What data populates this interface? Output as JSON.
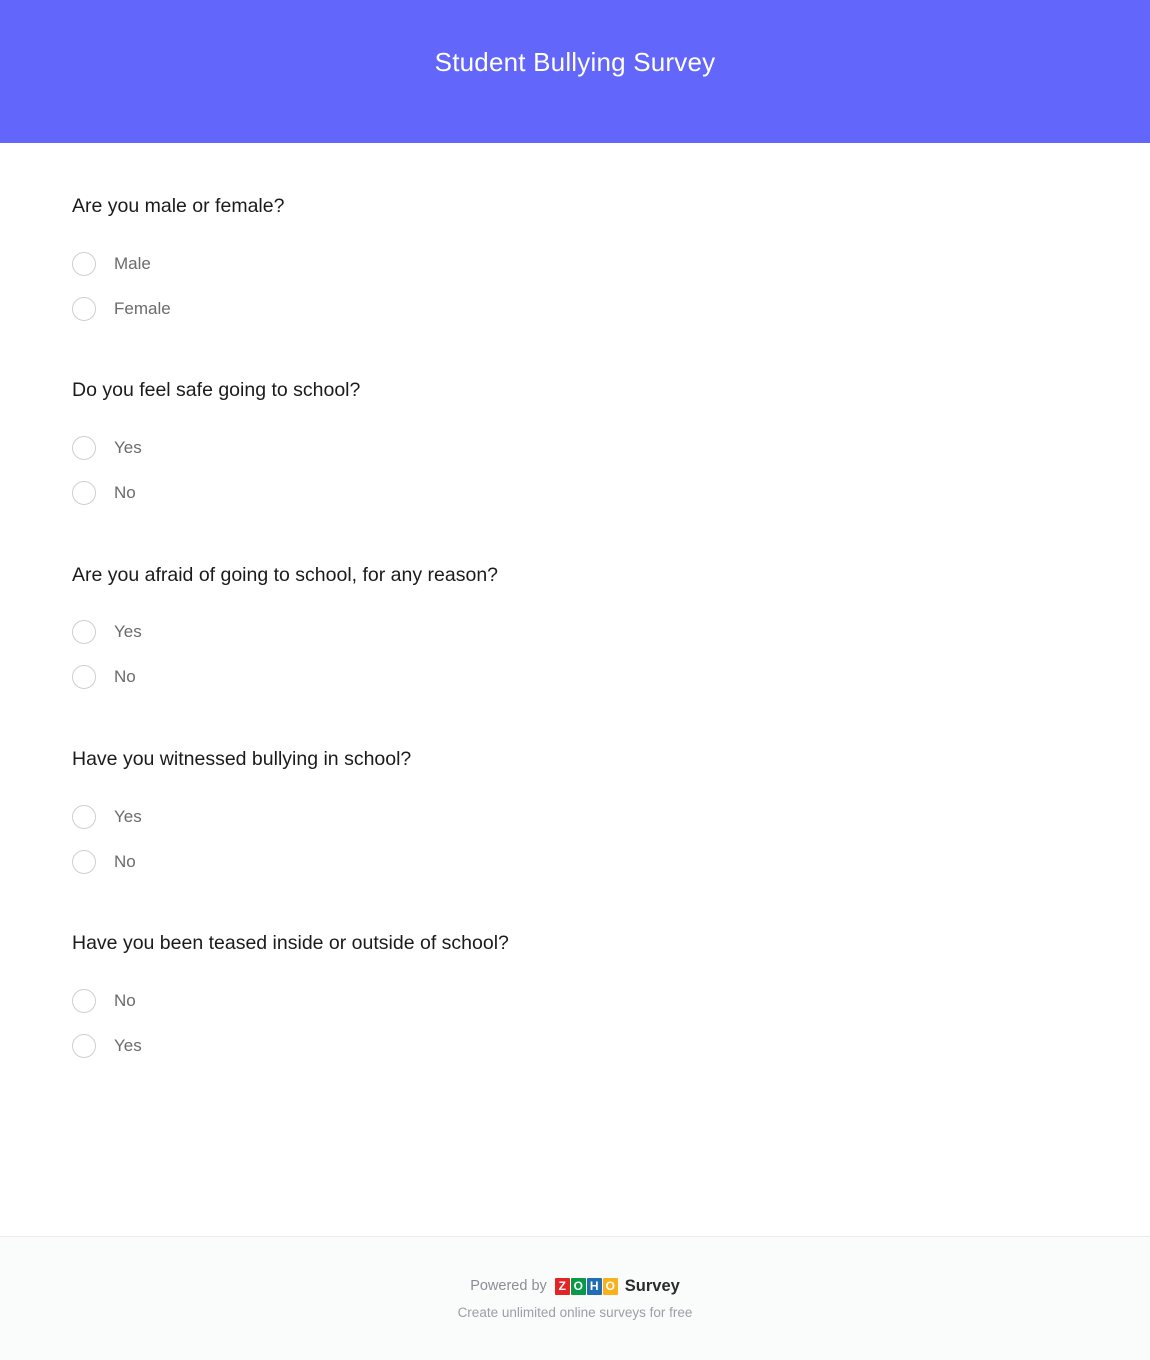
{
  "header": {
    "title": "Student Bullying Survey",
    "background_color": "#6366fa",
    "title_color": "#ffffff"
  },
  "questions": [
    {
      "text": "Are you male or female?",
      "options": [
        {
          "label": "Male"
        },
        {
          "label": "Female"
        }
      ]
    },
    {
      "text": "Do you feel safe going to school?",
      "options": [
        {
          "label": "Yes"
        },
        {
          "label": "No"
        }
      ]
    },
    {
      "text": "Are you afraid of going to school, for any reason?",
      "options": [
        {
          "label": "Yes"
        },
        {
          "label": "No"
        }
      ]
    },
    {
      "text": "Have you witnessed bullying in school?",
      "options": [
        {
          "label": "Yes"
        },
        {
          "label": "No"
        }
      ]
    },
    {
      "text": "Have you been teased inside or outside of school?",
      "options": [
        {
          "label": "No"
        },
        {
          "label": "Yes"
        }
      ]
    }
  ],
  "footer": {
    "powered_by": "Powered by",
    "brand_letters": [
      "Z",
      "O",
      "H",
      "O"
    ],
    "brand_colors": [
      "#e42527",
      "#089949",
      "#226db4",
      "#f9b21d"
    ],
    "product": "Survey",
    "tagline": "Create unlimited online surveys for free"
  }
}
